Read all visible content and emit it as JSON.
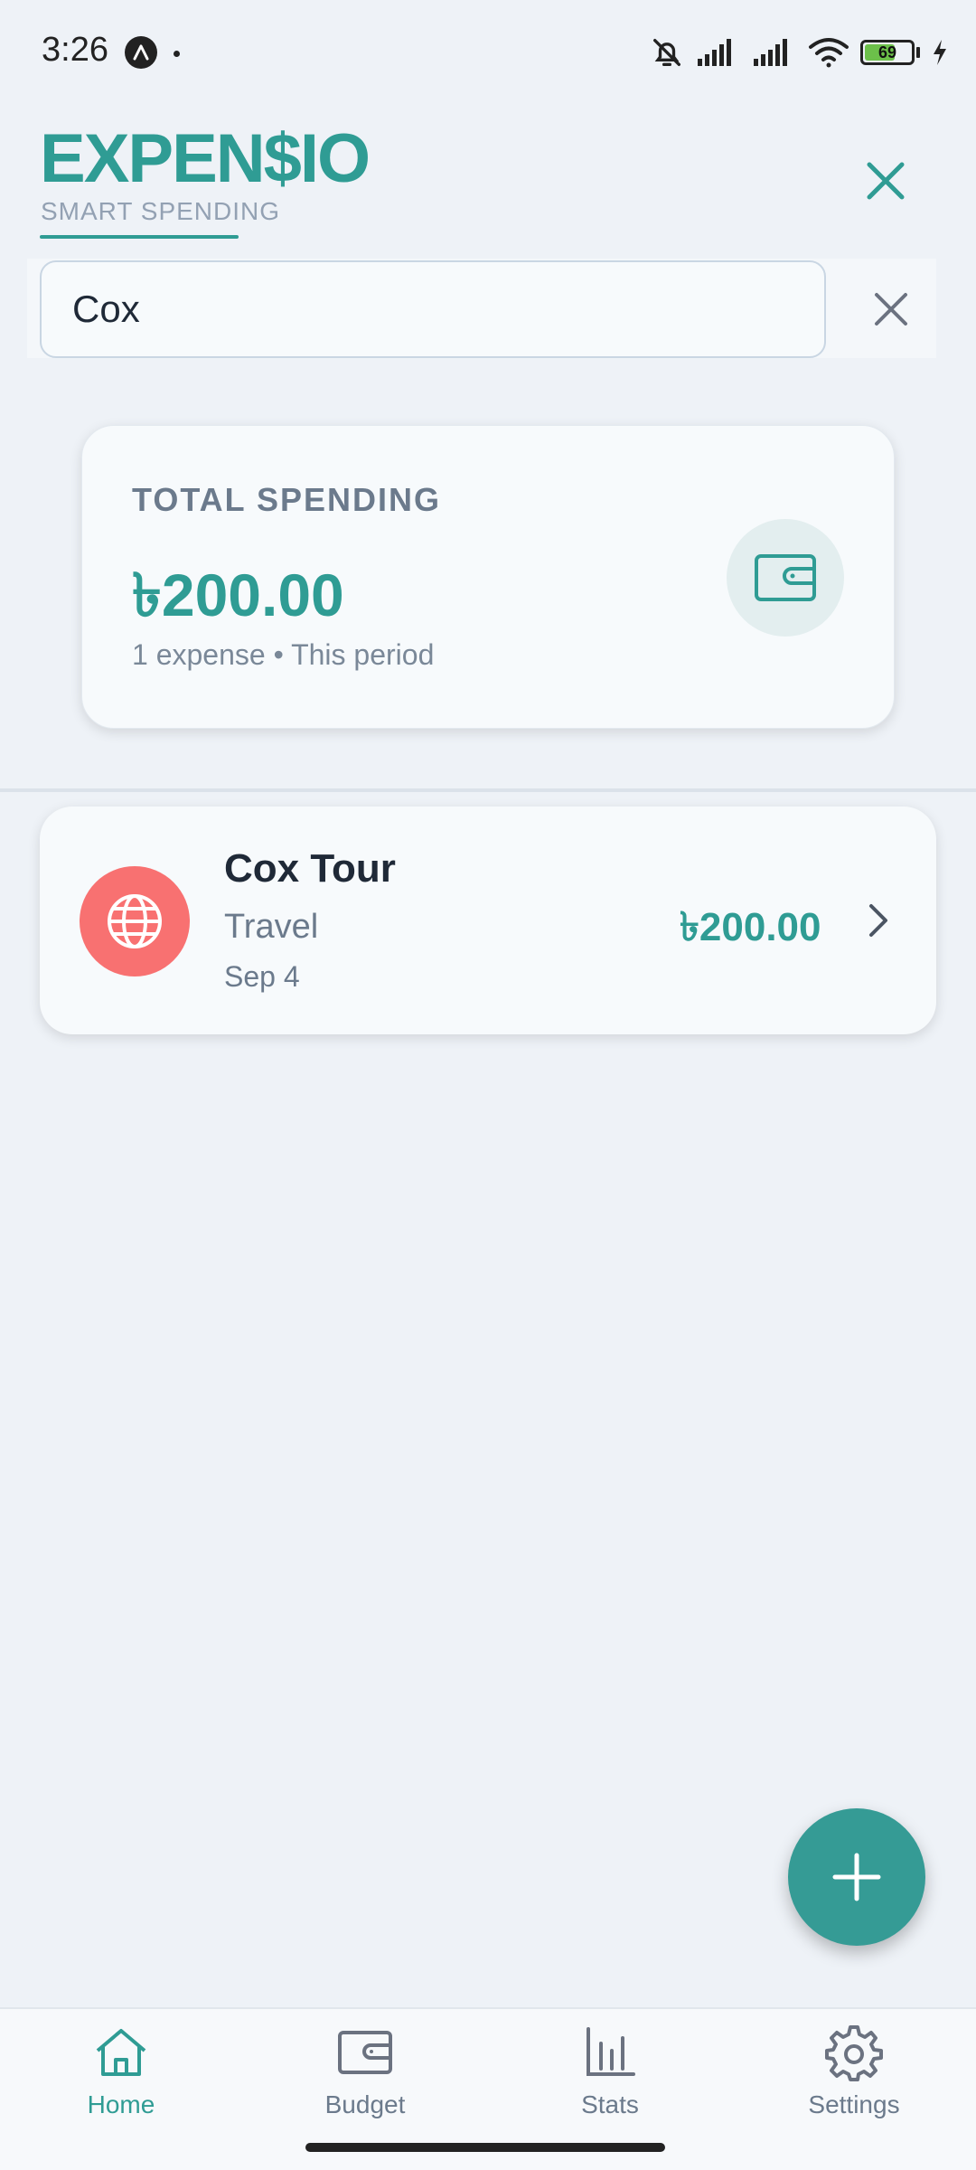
{
  "status_bar": {
    "time": "3:26",
    "battery_level": "69"
  },
  "header": {
    "logo": "EXPEN$IO",
    "tagline": "SMART SPENDING",
    "close_icon": "close-icon"
  },
  "search": {
    "value": "Cox",
    "clear_icon": "close-icon"
  },
  "summary": {
    "label": "TOTAL SPENDING",
    "amount": "৳200.00",
    "subtitle": "1 expense • This period",
    "icon": "wallet-icon"
  },
  "expenses": [
    {
      "title": "Cox Tour",
      "category": "Travel",
      "date": "Sep 4",
      "amount": "৳200.00",
      "icon": "globe-icon",
      "icon_color": "#f87171"
    }
  ],
  "fab": {
    "icon": "plus-icon"
  },
  "bottom_nav": {
    "items": [
      {
        "label": "Home",
        "icon": "home-icon",
        "active": true
      },
      {
        "label": "Budget",
        "icon": "wallet-icon",
        "active": false
      },
      {
        "label": "Stats",
        "icon": "bar-chart-icon",
        "active": false
      },
      {
        "label": "Settings",
        "icon": "gear-icon",
        "active": false
      }
    ]
  },
  "colors": {
    "accent": "#2f9c94",
    "background": "#eef2f7",
    "text_muted": "#6b7a8c"
  }
}
